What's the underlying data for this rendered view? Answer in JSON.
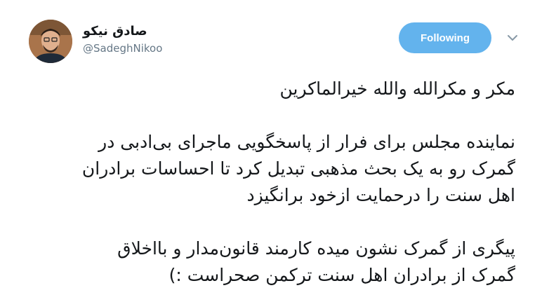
{
  "user": {
    "display_name": "صادق نیکو",
    "handle": "@SadeghNikoo",
    "avatar_icon": "user-avatar-photo"
  },
  "actions": {
    "follow_label": "Following",
    "follow_color": "#63b3ed",
    "menu_icon": "chevron-down-icon"
  },
  "tweet": {
    "paragraphs": [
      {
        "lines": [
          "مکر و مکرالله والله خیرالماکرین"
        ]
      },
      {
        "lines": [
          "نماینده مجلس برای فرار از پاسخگویی ماجرای بی‌ادبی در",
          "گمرک رو به یک بحث مذهبی تبدیل کرد تا احساسات برادران",
          "اهل سنت را درحمایت ازخود برانگیزد"
        ]
      },
      {
        "lines": [
          "پیگری از گمرک نشون میده کارمند قانون‌مدار و بااخلاق",
          "گمرک از برادران اهل سنت ترکمن صحراست :)"
        ]
      }
    ]
  }
}
